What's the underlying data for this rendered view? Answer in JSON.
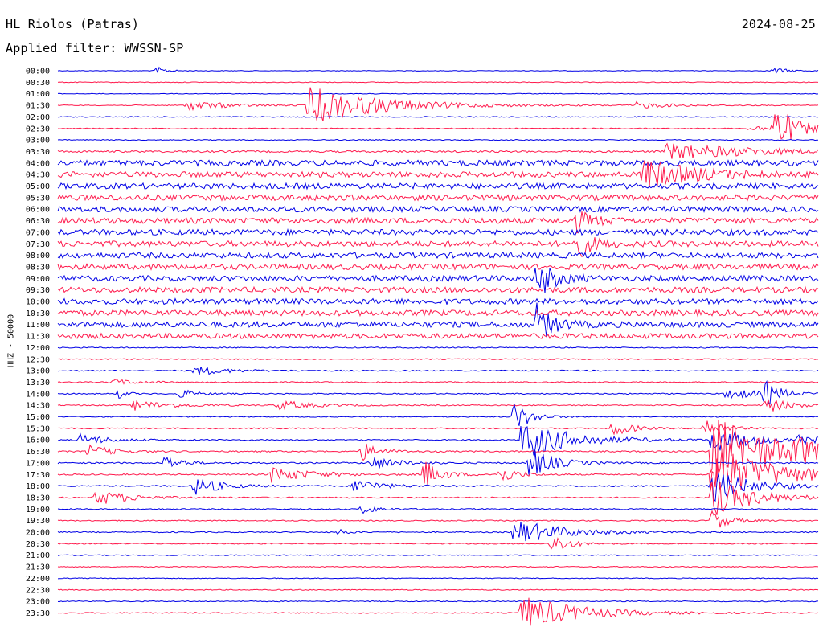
{
  "header": {
    "station": "HL Riolos (Patras)",
    "date": "2024-08-25",
    "filter": "Applied filter: WWSSN-SP"
  },
  "colors": {
    "trace_a": "#0000e6",
    "trace_b": "#ff1a4d",
    "background": "#ffffff"
  },
  "chart_data": {
    "type": "line",
    "title": "HL Riolos (Patras)",
    "subtitle": "Applied filter: WWSSN-SP",
    "date": "2024-08-25",
    "ylabel": "HHZ - 50000",
    "categories": [
      "00:00",
      "00:30",
      "01:00",
      "01:30",
      "02:00",
      "02:30",
      "03:00",
      "03:30",
      "04:00",
      "04:30",
      "05:00",
      "05:30",
      "06:00",
      "06:30",
      "07:00",
      "07:30",
      "08:00",
      "08:30",
      "09:00",
      "09:30",
      "10:00",
      "10:30",
      "11:00",
      "11:30",
      "12:00",
      "12:30",
      "13:00",
      "13:30",
      "14:00",
      "14:30",
      "15:00",
      "15:30",
      "16:00",
      "16:30",
      "17:00",
      "17:30",
      "18:00",
      "18:30",
      "19:00",
      "19:30",
      "20:00",
      "20:30",
      "21:00",
      "21:30",
      "22:00",
      "22:30",
      "23:00",
      "23:30"
    ],
    "row_colors": [
      "trace_a",
      "trace_b"
    ],
    "noise_level": [
      0.4,
      0.5,
      0.4,
      0.6,
      0.6,
      0.6,
      0.6,
      1.2,
      3.5,
      3.5,
      3.5,
      3.5,
      3.5,
      3.5,
      3.5,
      3.5,
      3.5,
      3.5,
      3.5,
      3.5,
      3.5,
      3.5,
      3.5,
      3.2,
      0.7,
      0.7,
      0.7,
      0.7,
      0.7,
      0.7,
      0.6,
      0.8,
      0.8,
      0.9,
      0.9,
      0.9,
      0.9,
      0.8,
      0.7,
      0.7,
      0.7,
      0.7,
      0.6,
      0.6,
      0.5,
      0.6,
      0.6,
      0.7
    ],
    "events": [
      {
        "row": 0,
        "t": 0.13,
        "amp": 5,
        "dur": 0.012
      },
      {
        "row": 0,
        "t": 0.94,
        "amp": 4,
        "dur": 0.02
      },
      {
        "row": 3,
        "t": 0.17,
        "amp": 6,
        "dur": 0.05
      },
      {
        "row": 3,
        "t": 0.33,
        "amp": 24,
        "dur": 0.09
      },
      {
        "row": 3,
        "t": 0.76,
        "amp": 4,
        "dur": 0.04
      },
      {
        "row": 5,
        "t": 0.91,
        "amp": 5,
        "dur": 0.02
      },
      {
        "row": 5,
        "t": 0.94,
        "amp": 30,
        "dur": 0.03
      },
      {
        "row": 7,
        "t": 0.8,
        "amp": 10,
        "dur": 0.12
      },
      {
        "row": 9,
        "t": 0.77,
        "amp": 18,
        "dur": 0.06
      },
      {
        "row": 13,
        "t": 0.68,
        "amp": 14,
        "dur": 0.02
      },
      {
        "row": 15,
        "t": 0.68,
        "amp": 20,
        "dur": 0.02
      },
      {
        "row": 18,
        "t": 0.63,
        "amp": 25,
        "dur": 0.02
      },
      {
        "row": 22,
        "t": 0.63,
        "amp": 24,
        "dur": 0.02
      },
      {
        "row": 26,
        "t": 0.18,
        "amp": 6,
        "dur": 0.04
      },
      {
        "row": 27,
        "t": 0.07,
        "amp": 4,
        "dur": 0.03
      },
      {
        "row": 28,
        "t": 0.08,
        "amp": 6,
        "dur": 0.01
      },
      {
        "row": 28,
        "t": 0.16,
        "amp": 6,
        "dur": 0.02
      },
      {
        "row": 28,
        "t": 0.88,
        "amp": 10,
        "dur": 0.03
      },
      {
        "row": 28,
        "t": 0.93,
        "amp": 15,
        "dur": 0.02
      },
      {
        "row": 29,
        "t": 0.1,
        "amp": 6,
        "dur": 0.05
      },
      {
        "row": 29,
        "t": 0.29,
        "amp": 6,
        "dur": 0.04
      },
      {
        "row": 29,
        "t": 0.93,
        "amp": 10,
        "dur": 0.03
      },
      {
        "row": 30,
        "t": 0.6,
        "amp": 20,
        "dur": 0.02
      },
      {
        "row": 31,
        "t": 0.73,
        "amp": 12,
        "dur": 0.02
      },
      {
        "row": 31,
        "t": 0.85,
        "amp": 15,
        "dur": 0.02
      },
      {
        "row": 32,
        "t": 0.03,
        "amp": 8,
        "dur": 0.03
      },
      {
        "row": 32,
        "t": 0.61,
        "amp": 25,
        "dur": 0.06
      },
      {
        "row": 32,
        "t": 0.86,
        "amp": 15,
        "dur": 0.05
      },
      {
        "row": 32,
        "t": 0.97,
        "amp": 8,
        "dur": 0.02
      },
      {
        "row": 33,
        "t": 0.04,
        "amp": 8,
        "dur": 0.03
      },
      {
        "row": 33,
        "t": 0.4,
        "amp": 12,
        "dur": 0.02
      },
      {
        "row": 33,
        "t": 0.86,
        "amp": 45,
        "dur": 0.08
      },
      {
        "row": 33,
        "t": 0.97,
        "amp": 14,
        "dur": 0.02
      },
      {
        "row": 34,
        "t": 0.14,
        "amp": 10,
        "dur": 0.02
      },
      {
        "row": 34,
        "t": 0.41,
        "amp": 10,
        "dur": 0.03
      },
      {
        "row": 34,
        "t": 0.62,
        "amp": 20,
        "dur": 0.03
      },
      {
        "row": 35,
        "t": 0.28,
        "amp": 10,
        "dur": 0.05
      },
      {
        "row": 35,
        "t": 0.48,
        "amp": 20,
        "dur": 0.02
      },
      {
        "row": 35,
        "t": 0.58,
        "amp": 12,
        "dur": 0.02
      },
      {
        "row": 35,
        "t": 0.86,
        "amp": 35,
        "dur": 0.08
      },
      {
        "row": 36,
        "t": 0.18,
        "amp": 12,
        "dur": 0.03
      },
      {
        "row": 36,
        "t": 0.39,
        "amp": 10,
        "dur": 0.03
      },
      {
        "row": 36,
        "t": 0.86,
        "amp": 20,
        "dur": 0.05
      },
      {
        "row": 37,
        "t": 0.05,
        "amp": 10,
        "dur": 0.04
      },
      {
        "row": 37,
        "t": 0.86,
        "amp": 25,
        "dur": 0.05
      },
      {
        "row": 38,
        "t": 0.4,
        "amp": 6,
        "dur": 0.02
      },
      {
        "row": 39,
        "t": 0.86,
        "amp": 14,
        "dur": 0.02
      },
      {
        "row": 40,
        "t": 0.37,
        "amp": 5,
        "dur": 0.01
      },
      {
        "row": 40,
        "t": 0.6,
        "amp": 16,
        "dur": 0.06
      },
      {
        "row": 41,
        "t": 0.65,
        "amp": 14,
        "dur": 0.02
      },
      {
        "row": 47,
        "t": 0.61,
        "amp": 22,
        "dur": 0.07
      }
    ]
  }
}
